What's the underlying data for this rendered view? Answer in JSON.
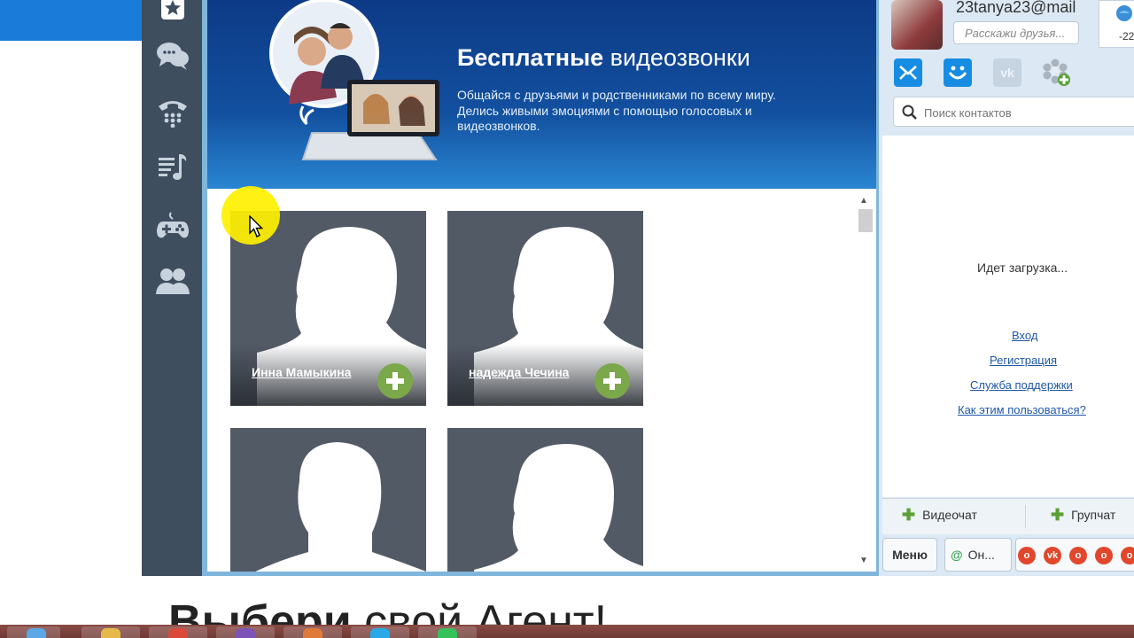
{
  "banner": {
    "title_bold": "Бесплатные",
    "title_rest": " видеозвонки",
    "text": "Общайся с друзьями и родственниками по всему миру. Делись живыми эмоциями с помощью голосовых и видеозвонков."
  },
  "sidebar": {
    "icons": [
      "star-icon",
      "chat-icon",
      "phone-icon",
      "music-icon",
      "gamepad-icon",
      "contacts-icon"
    ]
  },
  "contacts_grid": [
    {
      "name": "Инна Мамыкина",
      "gender": "female"
    },
    {
      "name": "надежда Чечина",
      "gender": "female"
    },
    {
      "name": "",
      "gender": "male"
    },
    {
      "name": "",
      "gender": "female"
    }
  ],
  "profile": {
    "email": "23tanya23@mail",
    "status_placeholder": "Расскажи друзья...",
    "weather": "-22"
  },
  "services": [
    "mail-icon",
    "moimir-icon",
    "vk-icon",
    "icq-add-icon"
  ],
  "search": {
    "placeholder": "Поиск контактов"
  },
  "contact_list": {
    "loading": "Идет загрузка...",
    "links": [
      "Вход",
      "Регистрация",
      "Служба поддержки",
      "Как этим пользоваться?"
    ]
  },
  "actions": {
    "videochat": "Видеочат",
    "groupchat": "Групчат"
  },
  "bottom": {
    "menu": "Меню",
    "online": "Он..."
  },
  "page": {
    "heading_bold": "Выбери",
    "heading_rest": " свой Агент!"
  },
  "colors": {
    "sidebar": "#3f4e5e",
    "banner": "#12509f",
    "accent": "#7aa84a",
    "link": "#1f57a8"
  }
}
